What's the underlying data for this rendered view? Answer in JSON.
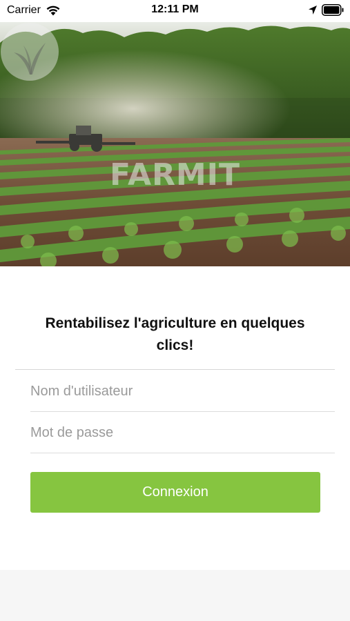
{
  "status_bar": {
    "carrier": "Carrier",
    "time": "12:11 PM",
    "icons": [
      "wifi-icon",
      "location-icon",
      "battery-icon"
    ]
  },
  "hero": {
    "logo_text": "FARMIT",
    "logo_icon": "sprout-logo-icon"
  },
  "login": {
    "tagline": "Rentabilisez l'agriculture en quelques clics!",
    "username_placeholder": "Nom d'utilisateur",
    "password_placeholder": "Mot de passe",
    "submit_label": "Connexion"
  },
  "colors": {
    "accent": "#86c540",
    "divider": "#d6d6d6",
    "placeholder": "#9a9a9a"
  }
}
